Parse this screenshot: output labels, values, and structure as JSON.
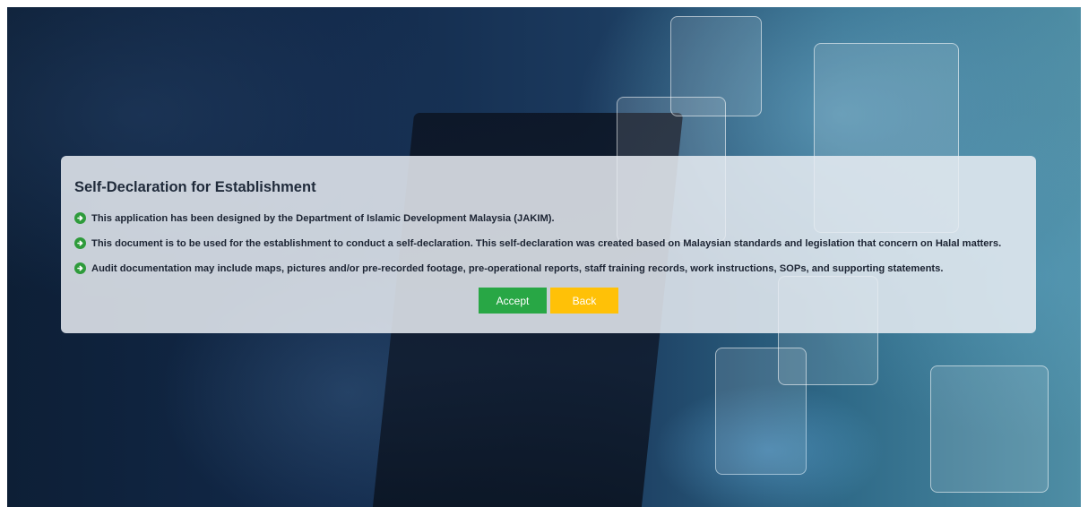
{
  "panel": {
    "title": "Self-Declaration for Establishment",
    "items": [
      "This application has been designed by the Department of Islamic Development Malaysia (JAKIM).",
      "This document is to be used for the establishment to conduct a self-declaration. This self-declaration was created based on Malaysian standards and legislation that concern on Halal matters.",
      "Audit documentation may include maps, pictures and/or pre-recorded footage, pre-operational reports, staff training records, work instructions, SOPs, and supporting statements."
    ],
    "bullet_icon": "arrow-circle-right-icon",
    "accept_label": "Accept",
    "back_label": "Back"
  },
  "colors": {
    "accept": "#28a745",
    "back": "#ffc107",
    "bullet": "#2e9b3b"
  }
}
